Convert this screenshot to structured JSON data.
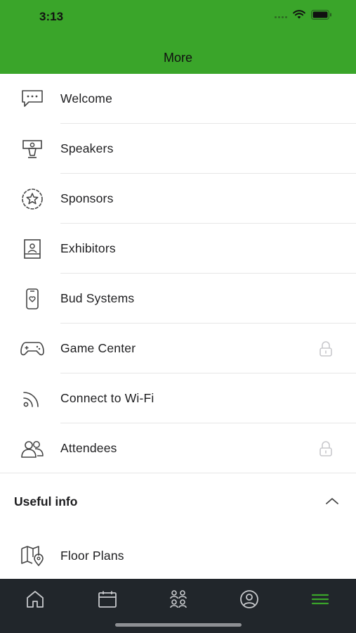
{
  "status_bar": {
    "time": "3:13"
  },
  "header": {
    "title": "More"
  },
  "menu_items": [
    {
      "label": "Welcome",
      "icon": "chat-bubble-icon",
      "locked": false
    },
    {
      "label": "Speakers",
      "icon": "podium-icon",
      "locked": false
    },
    {
      "label": "Sponsors",
      "icon": "star-badge-icon",
      "locked": false
    },
    {
      "label": "Exhibitors",
      "icon": "booth-icon",
      "locked": false
    },
    {
      "label": "Bud Systems",
      "icon": "phone-heart-icon",
      "locked": false
    },
    {
      "label": "Game Center",
      "icon": "gamepad-icon",
      "locked": true
    },
    {
      "label": "Connect to Wi-Fi",
      "icon": "wifi-icon",
      "locked": false
    },
    {
      "label": "Attendees",
      "icon": "people-icon",
      "locked": true
    }
  ],
  "useful_info": {
    "title": "Useful info",
    "expanded": true,
    "items": [
      {
        "label": "Floor Plans",
        "icon": "map-pin-icon"
      }
    ]
  },
  "tab_bar": {
    "tabs": [
      "home-icon",
      "calendar-icon",
      "attendees-icon",
      "profile-icon",
      "menu-icon"
    ],
    "active": "menu-icon"
  },
  "colors": {
    "header": "#3aa52a",
    "tab_bar": "#21262b",
    "tab_active": "#3aa52a",
    "tab_inactive": "#c7c9cc",
    "lock": "#c8c8cc"
  }
}
